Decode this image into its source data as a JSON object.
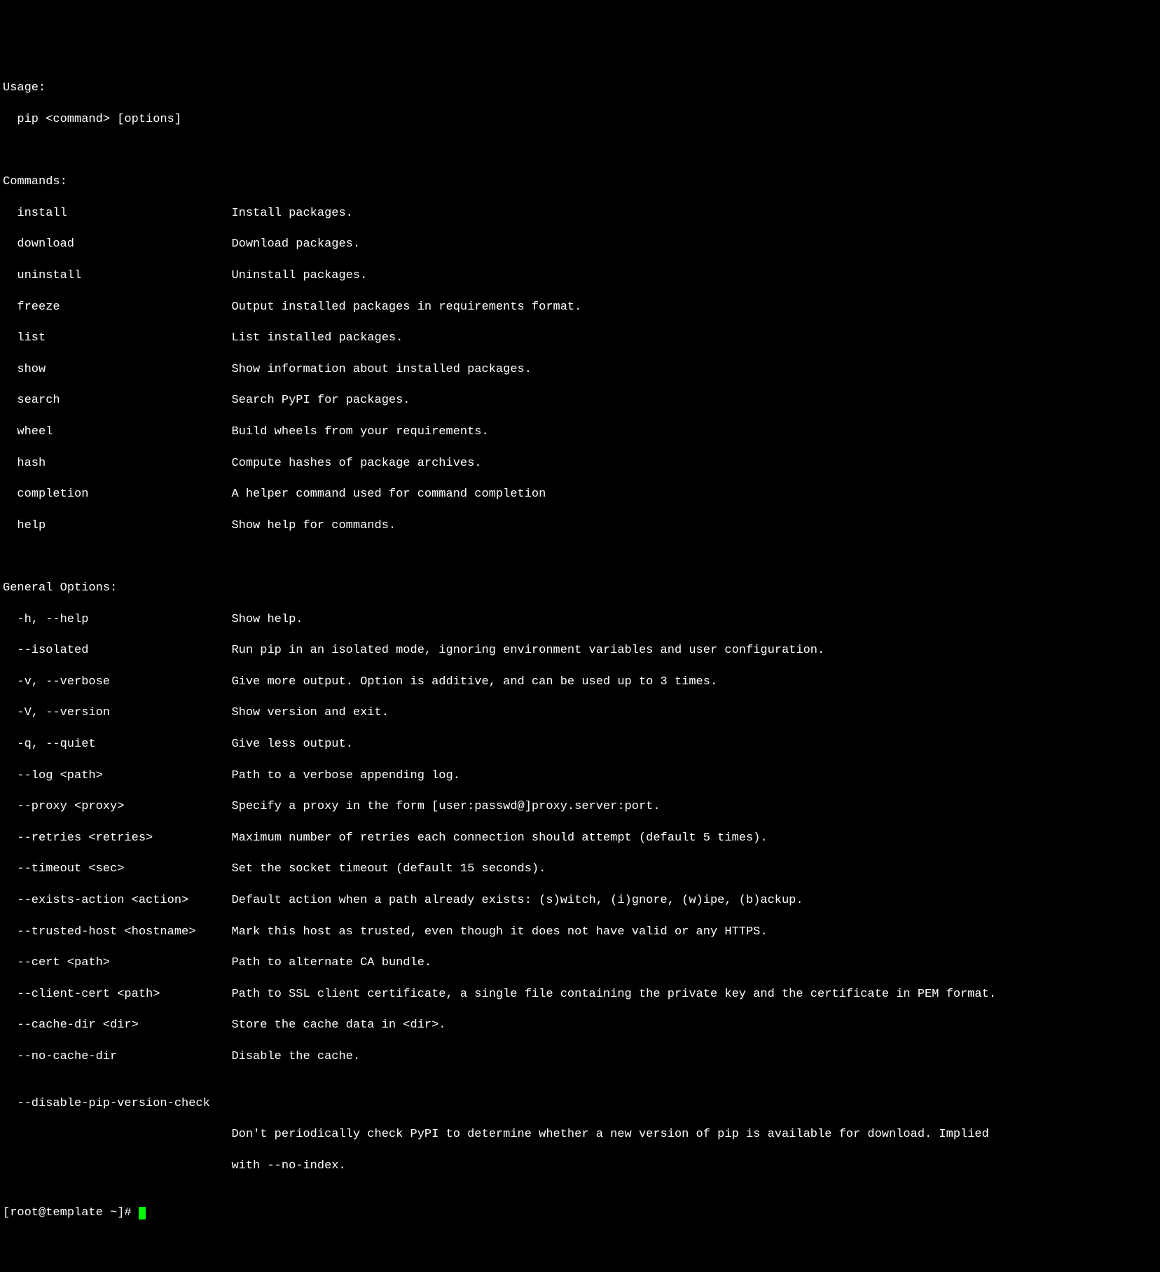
{
  "usage": {
    "header": "Usage:",
    "text": "pip <command> [options]"
  },
  "commands": {
    "header": "Commands:",
    "items": [
      {
        "name": "install",
        "desc": "Install packages."
      },
      {
        "name": "download",
        "desc": "Download packages."
      },
      {
        "name": "uninstall",
        "desc": "Uninstall packages."
      },
      {
        "name": "freeze",
        "desc": "Output installed packages in requirements format."
      },
      {
        "name": "list",
        "desc": "List installed packages."
      },
      {
        "name": "show",
        "desc": "Show information about installed packages."
      },
      {
        "name": "search",
        "desc": "Search PyPI for packages."
      },
      {
        "name": "wheel",
        "desc": "Build wheels from your requirements."
      },
      {
        "name": "hash",
        "desc": "Compute hashes of package archives."
      },
      {
        "name": "completion",
        "desc": "A helper command used for command completion"
      },
      {
        "name": "help",
        "desc": "Show help for commands."
      }
    ]
  },
  "options": {
    "header": "General Options:",
    "items": [
      {
        "name": "-h, --help",
        "desc": "Show help."
      },
      {
        "name": "--isolated",
        "desc": "Run pip in an isolated mode, ignoring environment variables and user configuration."
      },
      {
        "name": "-v, --verbose",
        "desc": "Give more output. Option is additive, and can be used up to 3 times."
      },
      {
        "name": "-V, --version",
        "desc": "Show version and exit."
      },
      {
        "name": "-q, --quiet",
        "desc": "Give less output."
      },
      {
        "name": "--log <path>",
        "desc": "Path to a verbose appending log."
      },
      {
        "name": "--proxy <proxy>",
        "desc": "Specify a proxy in the form [user:passwd@]proxy.server:port."
      },
      {
        "name": "--retries <retries>",
        "desc": "Maximum number of retries each connection should attempt (default 5 times)."
      },
      {
        "name": "--timeout <sec>",
        "desc": "Set the socket timeout (default 15 seconds)."
      },
      {
        "name": "--exists-action <action>",
        "desc": "Default action when a path already exists: (s)witch, (i)gnore, (w)ipe, (b)ackup."
      },
      {
        "name": "--trusted-host <hostname>",
        "desc": "Mark this host as trusted, even though it does not have valid or any HTTPS."
      },
      {
        "name": "--cert <path>",
        "desc": "Path to alternate CA bundle."
      },
      {
        "name": "--client-cert <path>",
        "desc": "Path to SSL client certificate, a single file containing the private key and the certificate in PEM format."
      },
      {
        "name": "--cache-dir <dir>",
        "desc": "Store the cache data in <dir>."
      },
      {
        "name": "--no-cache-dir",
        "desc": "Disable the cache."
      }
    ],
    "long_option": {
      "name": "--disable-pip-version-check",
      "desc_line1": "Don't periodically check PyPI to determine whether a new version of pip is available for download. Implied",
      "desc_line2": "with --no-index."
    }
  },
  "prompt": "[root@template ~]# "
}
